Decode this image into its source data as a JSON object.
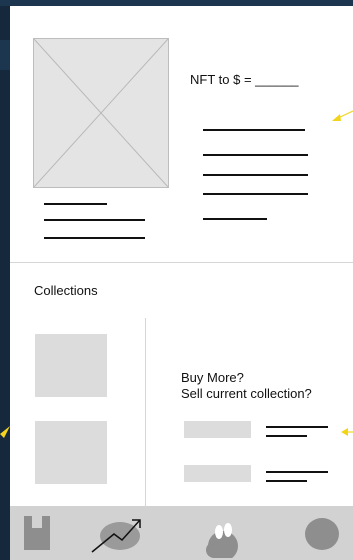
{
  "nft_detail": {
    "conversion_label": "NFT to $ = ______"
  },
  "collections": {
    "title": "Collections",
    "prompt_line_1": "Buy More?",
    "prompt_line_2": "Sell current collection?"
  },
  "bottom_nav": {
    "icons": [
      "wallet-icon",
      "trend-chart-icon",
      "coins-icon",
      "profile-icon"
    ]
  },
  "colors": {
    "backdrop": "#16283c",
    "card": "#ffffff",
    "placeholder": "#dcdcdc",
    "nav_bar": "#d2d2d2",
    "icon": "#8e8e8e",
    "annotation_arrow": "#f2d41c"
  }
}
